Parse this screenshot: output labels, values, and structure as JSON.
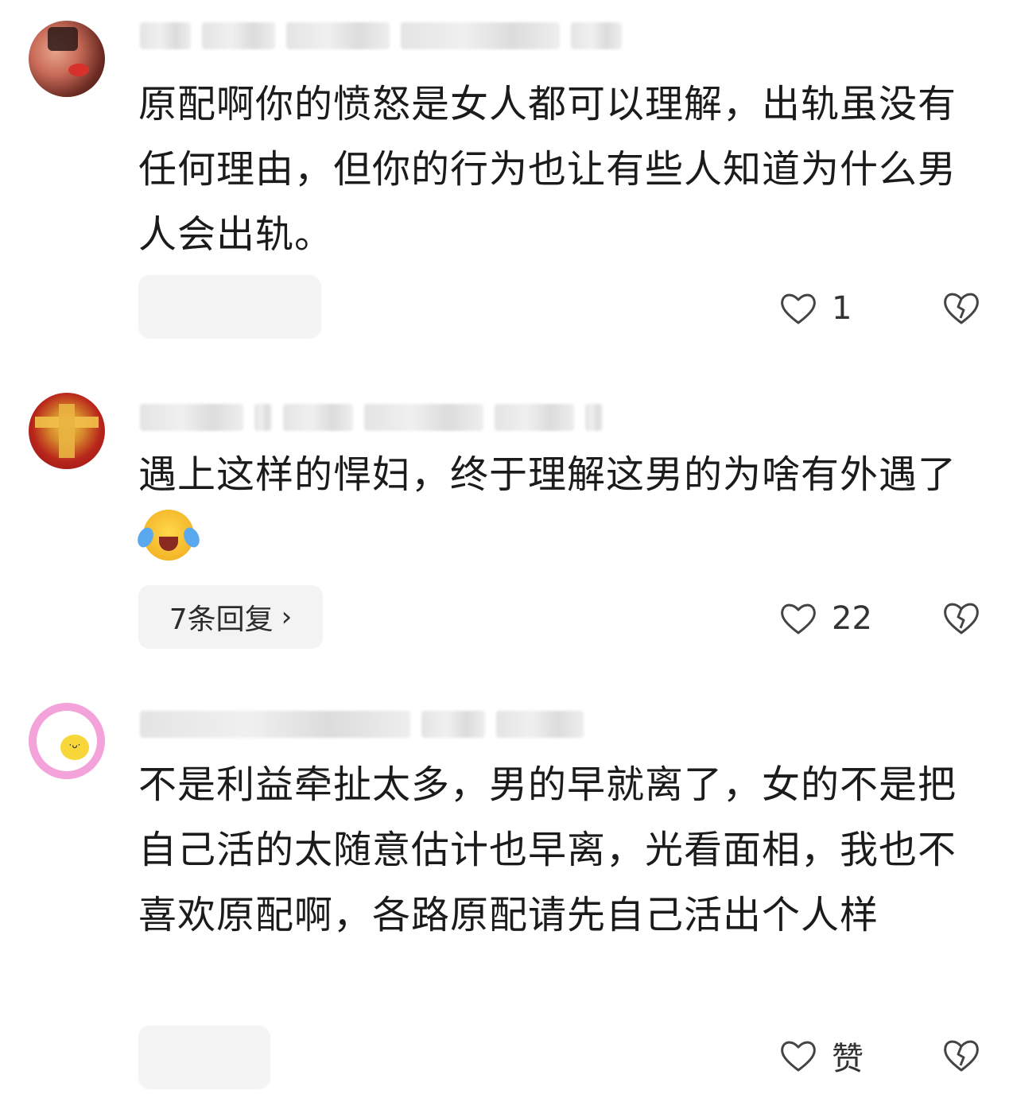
{
  "comments": [
    {
      "text": "原配啊你的愤怒是女人都可以理解，出轨虽没有任何理由，但你的行为也让有些人知道为什么男人会出轨。",
      "likes": "1",
      "avatar_icon": "photo-avatar"
    },
    {
      "text": "遇上这样的悍妇，终于理解这男的为啥有外遇了",
      "emoji": "laughing-crying-emoji",
      "reply_label": "7条回复",
      "likes": "22",
      "avatar_icon": "photo-avatar"
    },
    {
      "text": "不是利益牵扯太多，男的早就离了，女的不是把自己活的太随意估计也早离，光看面相，我也不喜欢原配啊，各路原配请先自己活出个人样",
      "likes": "赞",
      "avatar_icon": "egg-avatar",
      "avatar_face": "·ᴗ·"
    }
  ],
  "icons": {
    "like": "heart-outline-icon",
    "dislike": "broken-heart-icon",
    "chevron": "chevron-right-icon",
    "chevron_glyph": "›"
  },
  "colors": {
    "text": "#1b1b1b",
    "pill": "#f3f3f3",
    "icon": "#444444"
  }
}
